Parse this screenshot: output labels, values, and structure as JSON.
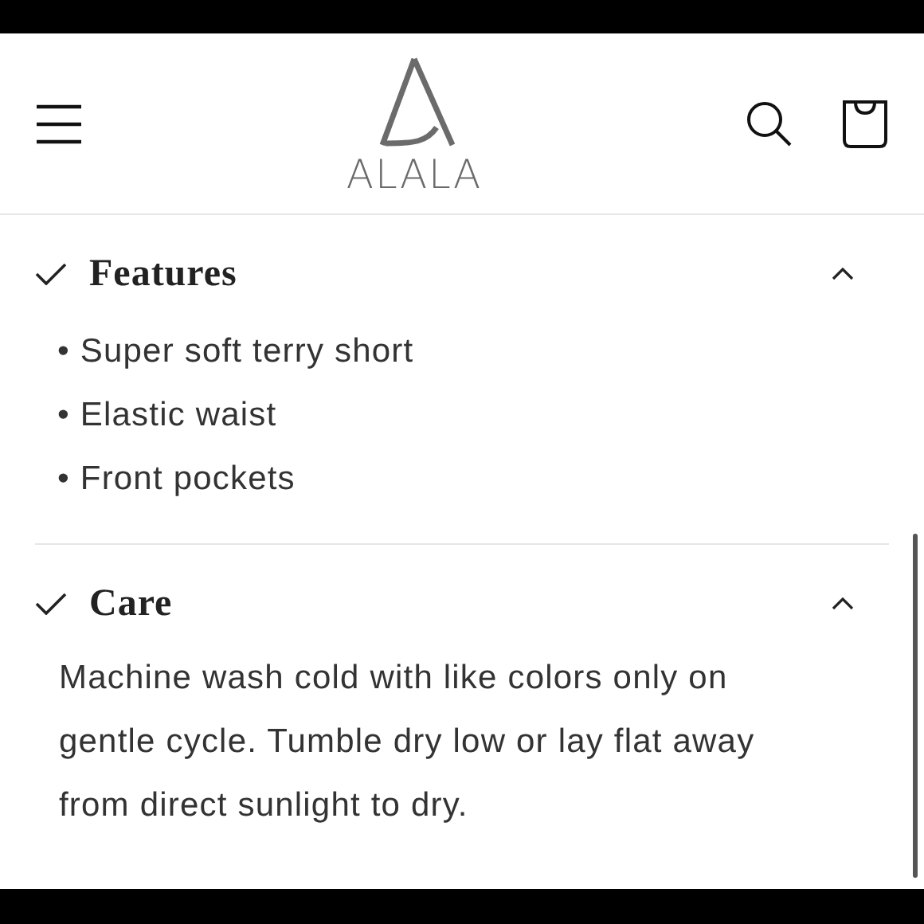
{
  "header": {
    "logo": "ALALA"
  },
  "sections": [
    {
      "title": "Features",
      "expanded": true,
      "kind": "list",
      "items": [
        "• Super soft terry short",
        "• Elastic waist",
        "• Front pockets"
      ]
    },
    {
      "title": "Care",
      "expanded": true,
      "kind": "text",
      "text": "Machine wash cold with like colors only on gentle cycle. Tumble dry low or lay flat away from direct sunlight to dry."
    }
  ]
}
